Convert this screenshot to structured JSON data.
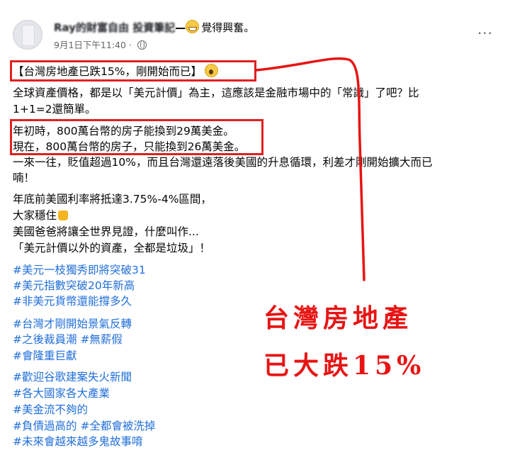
{
  "header": {
    "author_name": "Ray的財富自由 投資筆記",
    "separator": "—",
    "feeling": "覺得興奮。",
    "timestamp": "9月1日下午11:40",
    "dot": "·",
    "more_label": "···"
  },
  "post": {
    "line1": "【台灣房地產已跌15%，剛開始而已】",
    "line2": "全球資產價格，都是以「美元計價」為主，這應該是金融市場中的「常識」了吧？比",
    "line3": "1+1=2還簡單。",
    "line4": "年初時，800萬台幣的房子能換到29萬美金。",
    "line5": "現在，800萬台幣的房子，只能換到26萬美金。",
    "line6": "一來一往，貶值超過10%，而且台灣還遠落後美國的升息循環，利差才剛開始擴大而已",
    "line7": "喃！",
    "line8": "年底前美國利率將抵達3.75%-4%區間，",
    "line9": "大家穩住",
    "line10": "美國爸爸將讓全世界見證，什麼叫作...",
    "line11": "「美元計價以外的資產，全都是垃圾」！"
  },
  "hashtags": {
    "h1": "#美元一枝獨秀即將突破31",
    "h2": "#美元指數突破20年新高",
    "h3": "#非美元貨幣還能撐多久",
    "h4": "#台灣才剛開始景氣反轉",
    "h5a": "#之後裁員潮",
    "h5b": "#無薪假",
    "h6": "#會隆重巨獻",
    "h7": "#歡迎谷歌建案失火新聞",
    "h8": "#各大國家各大產業",
    "h9": "#美金流不夠的",
    "h10a": "#負債過高的",
    "h10b": "#全都會被洗掉",
    "h11": "#未來會越來越多鬼故事唷"
  },
  "annotation": {
    "line1": "台灣房地產",
    "line2": "已大跌15%",
    "color": "#e81414"
  },
  "colors": {
    "hashtag": "#216fdb",
    "meta": "#65676b",
    "text": "#050505"
  }
}
